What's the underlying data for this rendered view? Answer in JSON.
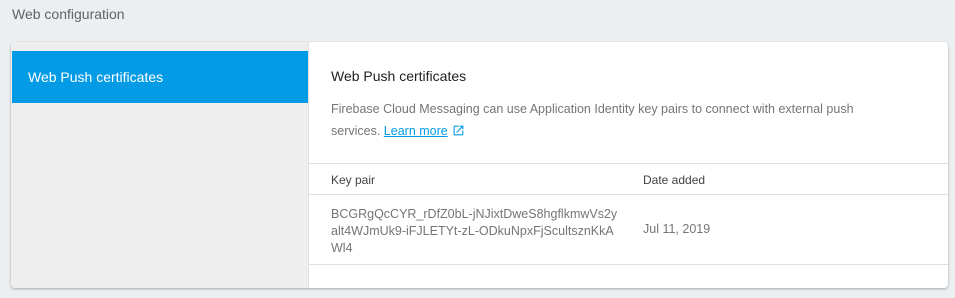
{
  "section_title": "Web configuration",
  "sidebar": {
    "items": [
      {
        "label": "Web Push certificates",
        "active": true
      }
    ]
  },
  "content": {
    "title": "Web Push certificates",
    "description": "Firebase Cloud Messaging can use Application Identity key pairs to connect with external push services.",
    "learn_more_label": "Learn more",
    "learn_more_icon": "open-in-new-icon"
  },
  "table": {
    "headers": {
      "key_pair": "Key pair",
      "date_added": "Date added"
    },
    "rows": [
      {
        "key_pair": "BCGRgQcCYR_rDfZ0bL-jNJixtDweS8hgflkmwVs2yalt4WJmUk9-iFJLETYt-zL-ODkuNpxFjScultsznKkAWl4",
        "date_added": "Jul 11, 2019"
      }
    ]
  },
  "colors": {
    "accent": "#039be5",
    "page_background": "#eceff1",
    "sidebar_background": "#eeeeee"
  }
}
